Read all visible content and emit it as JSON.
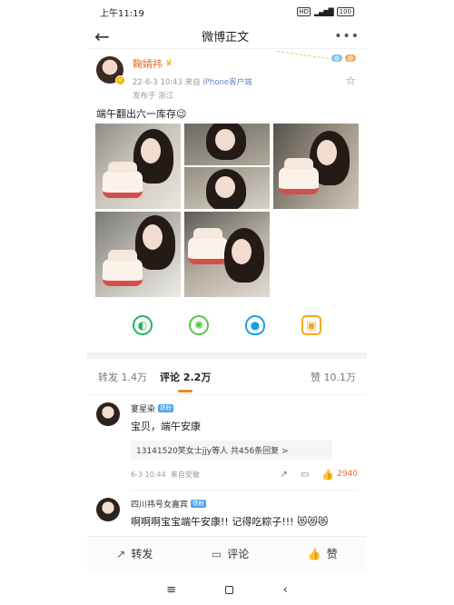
{
  "status_bar": {
    "time": "上午11:19",
    "battery": "100"
  },
  "nav": {
    "title": "微博正文",
    "back_icon": "arrow-left-icon",
    "more_icon": "more-icon"
  },
  "author": {
    "name": "鞠婧祎",
    "time": "22-6-3 10:43",
    "source_prefix": "来自",
    "source": "iPhone客户端",
    "location": "发布于 浙江"
  },
  "post": {
    "text": "端午翻出六一库存😉"
  },
  "share": [
    "wechat-icon",
    "moments-icon",
    "qq-icon",
    "save-image-icon"
  ],
  "tabs": {
    "repost": "转发 1.4万",
    "comment": "评论 2.2万",
    "like": "赞 10.1万"
  },
  "comments": [
    {
      "name": "宴星染",
      "badge": "铁粉",
      "text": "宝贝，端午安康",
      "replies": "13141520笑女士jjy等人  共456条回复 >",
      "time": "6-3 10:44",
      "source": "来自安徽",
      "likes": "2940"
    },
    {
      "name": "四川祎号女嘉宾",
      "badge": "铁粉",
      "text": "啊啊啊宝宝端午安康!! 记得吃粽子!!! 😻😻😻"
    }
  ],
  "bottom_bar": {
    "repost": "转发",
    "comment": "评论",
    "like": "赞"
  }
}
